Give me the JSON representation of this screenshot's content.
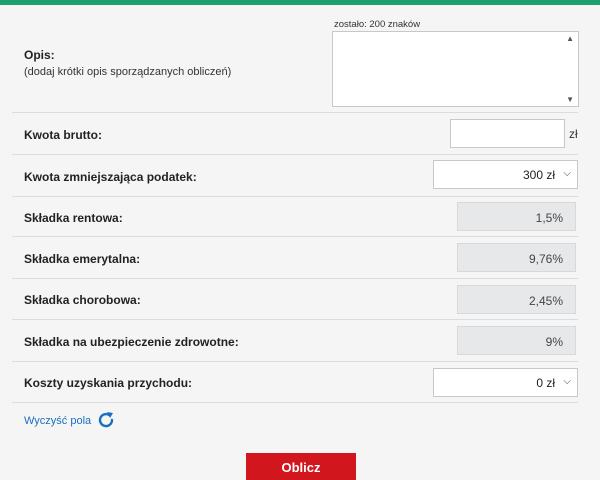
{
  "description": {
    "label": "Opis:",
    "sublabel": "(dodaj krótki opis sporządzanych obliczeń)",
    "counter": "zostało: 200 znaków",
    "value": ""
  },
  "gross": {
    "label": "Kwota brutto:",
    "value": "",
    "unit": "zł"
  },
  "tax_reducing": {
    "label": "Kwota zmniejszająca podatek:",
    "value": "300 zł"
  },
  "pension": {
    "label": "Składka rentowa:",
    "value": "1,5%"
  },
  "retirement": {
    "label": "Składka emerytalna:",
    "value": "9,76%"
  },
  "sickness": {
    "label": "Składka chorobowa:",
    "value": "2,45%"
  },
  "health": {
    "label": "Składka na ubezpieczenie zdrowotne:",
    "value": "9%"
  },
  "costs": {
    "label": "Koszty uzyskania przychodu:",
    "value": "0 zł"
  },
  "actions": {
    "clear_label": "Wyczyść pola",
    "calculate_label": "Oblicz"
  },
  "colors": {
    "accent": "#1f9e6e",
    "button": "#d2161e",
    "link": "#1a6fc0"
  }
}
